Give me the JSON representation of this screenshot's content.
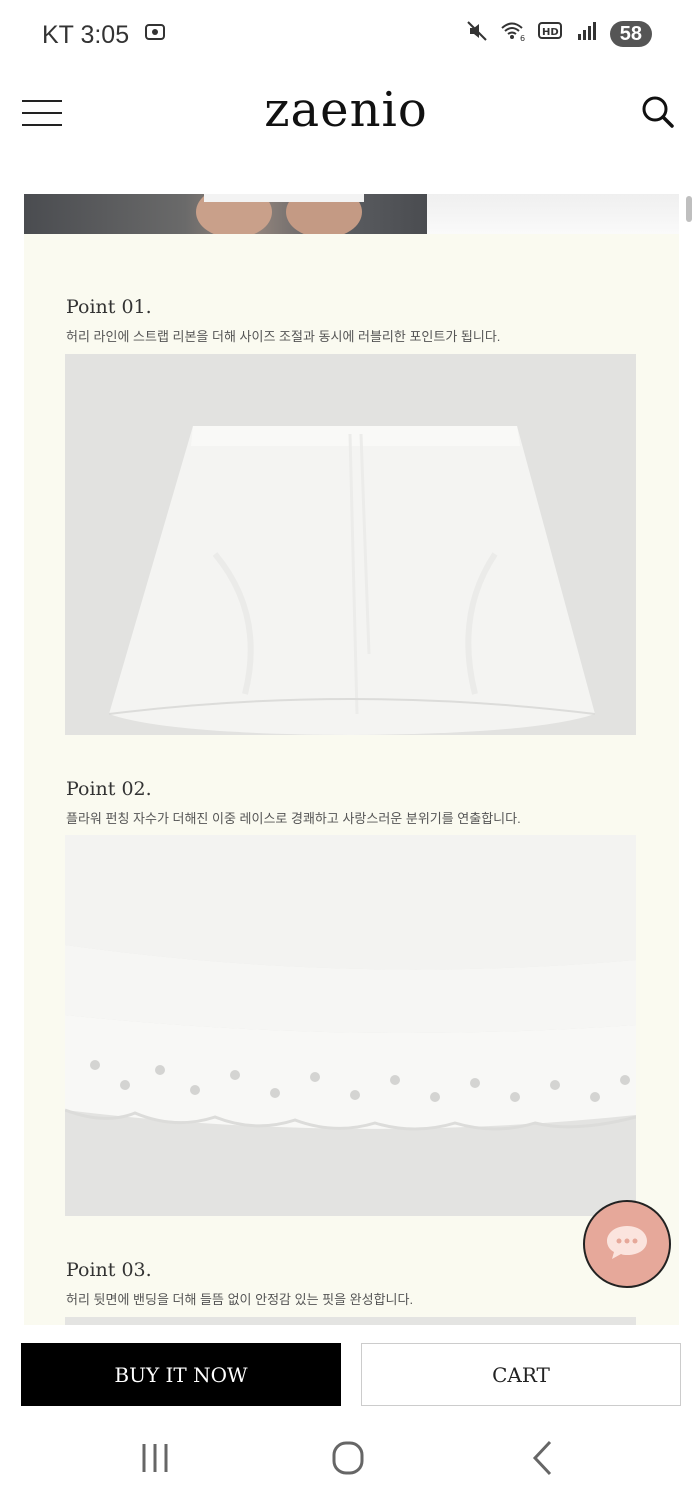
{
  "status_bar": {
    "carrier_time": "KT 3:05",
    "battery": "58",
    "icons": [
      "screenshot-icon",
      "mute-icon",
      "wifi-6-icon",
      "hd-icon",
      "signal-icon",
      "battery-icon"
    ]
  },
  "header": {
    "logo": "zaenio",
    "icons": [
      "menu-icon",
      "search-icon"
    ]
  },
  "points": [
    {
      "title": "Point 01.",
      "description": "허리 라인에 스트랩 리본을 더해 사이즈 조절과 동시에 러블리한 포인트가 됩니다."
    },
    {
      "title": "Point 02.",
      "description": "플라워 펀칭 자수가 더해진 이중 레이스로 경쾌하고 사랑스러운 분위기를 연출합니다."
    },
    {
      "title": "Point 03.",
      "description": "허리 뒷면에 밴딩을 더해 들뜸 없이 안정감 있는 핏을 완성합니다."
    }
  ],
  "actions": {
    "buy_label": "BUY IT NOW",
    "cart_label": "CART"
  },
  "chat": {
    "icon": "chat-bubble-icon",
    "color": "#e6a89a"
  },
  "navbar": {
    "icons": [
      "recent-apps-icon",
      "home-icon",
      "back-icon"
    ]
  }
}
